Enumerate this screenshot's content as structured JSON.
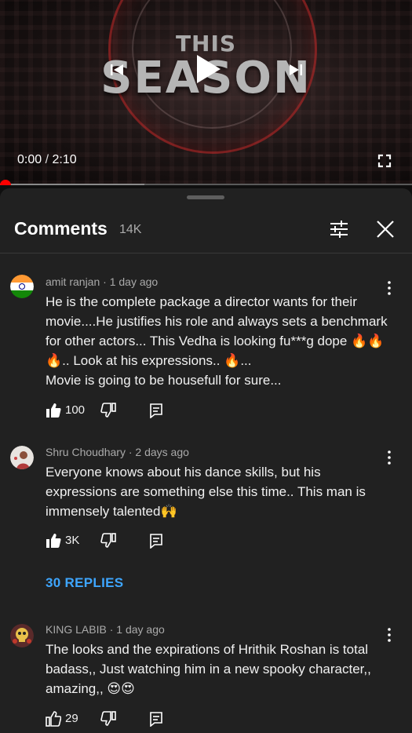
{
  "video": {
    "title_line1": "THIS",
    "title_line2": "SEASON",
    "current_time": "0:00",
    "separator": "/",
    "duration": "2:10",
    "progress_fraction": 0.0,
    "buffered_fraction": 0.35
  },
  "comments_panel": {
    "title": "Comments",
    "count": "14K",
    "comments": [
      {
        "author": "amit ranjan",
        "time": "1 day ago",
        "text": "He is the complete package a director wants for their movie....He justifies his role and always sets a benchmark for other actors... This Vedha is looking fu***g dope 🔥🔥🔥.. Look at his expressions.. 🔥...\nMovie is going to be housefull for sure...",
        "likes": "100",
        "avatar_icon": "india-flag-icon"
      },
      {
        "author": "Shru Choudhary",
        "time": "2 days ago",
        "text": "Everyone knows about his dance skills, but his expressions are something else this time.. This man is immensely talented🙌",
        "likes": "3K",
        "replies_label": "30 REPLIES",
        "avatar_icon": "profile-photo-icon"
      },
      {
        "author": "KING LABIB",
        "time": "1 day ago",
        "text": "The looks and the expirations of Hrithik Roshan is total badass,, Just watching him in a new spooky character,, amazing,, 😍😍",
        "likes": "29",
        "avatar_icon": "skull-avatar-icon"
      }
    ]
  },
  "colors": {
    "background": "#0f0f0f",
    "sheet": "#212121",
    "accent_red": "#ff0000",
    "link_blue": "#3ea6ff",
    "secondary_text": "#aaaaaa"
  }
}
